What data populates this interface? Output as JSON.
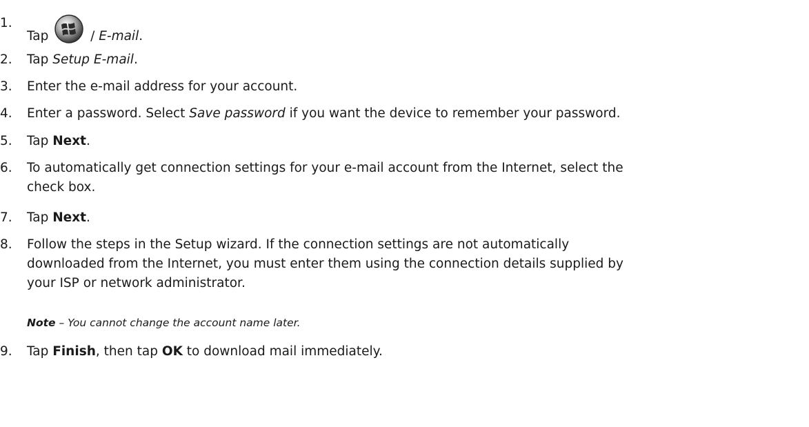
{
  "steps": [
    {
      "num": "1.",
      "a": "Tap ",
      "sep": " / ",
      "b": "E-mail",
      "c": "."
    },
    {
      "num": "2.",
      "a": "Tap ",
      "b": "Setup E-mail",
      "c": "."
    },
    {
      "num": "3.",
      "a": "Enter the e-mail address for your account."
    },
    {
      "num": "4.",
      "a": "Enter a password. Select ",
      "b": "Save password",
      "c": " if you want the device to remember your password."
    },
    {
      "num": "5.",
      "a": "Tap ",
      "b": "Next",
      "c": "."
    },
    {
      "num": "6.",
      "line1": "To automatically get connection settings for your e-mail account from the Internet, select the",
      "line2": "check box."
    },
    {
      "num": "7.",
      "a": "Tap ",
      "b": "Next",
      "c": "."
    },
    {
      "num": "8.",
      "line1": "Follow the steps in the Setup wizard. If the connection settings are not automatically",
      "line2": "downloaded from the Internet, you must enter them using the connection details supplied by",
      "line3": "your ISP or network administrator."
    },
    {
      "num": "9.",
      "a": "Tap ",
      "b": "Finish",
      "c": ", then tap ",
      "d": "OK",
      "e": " to download mail immediately."
    }
  ],
  "note": {
    "label": "Note",
    "dash": " – ",
    "text": "You cannot change the account name later."
  },
  "icons": {
    "start": "windows-start-icon"
  }
}
